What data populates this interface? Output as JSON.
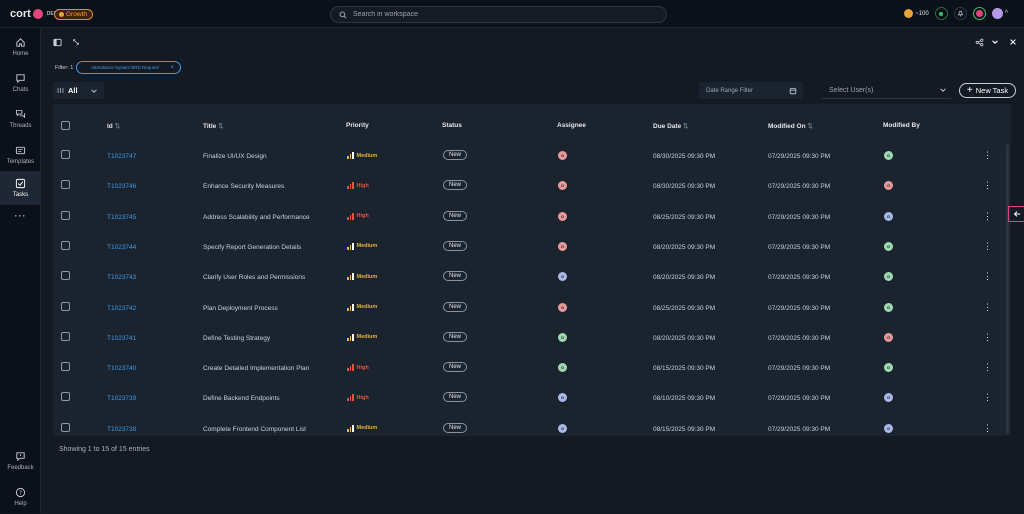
{
  "app": {
    "logo_text": "cort",
    "env": "DEV",
    "plan_badge": "Growth"
  },
  "search": {
    "placeholder": "Search in workspace"
  },
  "topbar": {
    "credits": "~100"
  },
  "sidebar": {
    "items": [
      {
        "label": "Home",
        "icon": "home-icon"
      },
      {
        "label": "Chats",
        "icon": "chat-icon"
      },
      {
        "label": "Threads",
        "icon": "threads-icon"
      },
      {
        "label": "Templates",
        "icon": "templates-icon"
      },
      {
        "label": "Tasks",
        "icon": "tasks-icon"
      },
      {
        "label": "Feedback",
        "icon": "feedback-icon"
      },
      {
        "label": "Help",
        "icon": "help-icon"
      }
    ]
  },
  "filter": {
    "count_label": "Filter: 1",
    "chip_label": "Attendance System BRD Request"
  },
  "view": {
    "selected": "All"
  },
  "controls": {
    "date_range_placeholder": "Date Range Filter",
    "user_select_placeholder": "Select User(s)",
    "new_task_label": "New Task"
  },
  "table": {
    "columns": [
      "Id",
      "Title",
      "Priority",
      "Status",
      "Assignee",
      "Due Date",
      "Modified On",
      "Modified By"
    ],
    "rows": [
      {
        "id": "T1023747",
        "title": "Finalize UI/UX Design",
        "priority": "Medium",
        "status": "New",
        "due": "08/30/2025 09:30 PM",
        "modified": "07/29/2025 09:30 PM",
        "assignee_color": "#e89a9a",
        "modby_color": "#9ed9b0"
      },
      {
        "id": "T1023746",
        "title": "Enhance Security Measures",
        "priority": "High",
        "status": "New",
        "due": "08/30/2025 09:30 PM",
        "modified": "07/29/2025 09:30 PM",
        "assignee_color": "#e89a9a",
        "modby_color": "#e89a9a"
      },
      {
        "id": "T1023745",
        "title": "Address Scalability and Performance",
        "priority": "High",
        "status": "New",
        "due": "08/25/2025 09:30 PM",
        "modified": "07/29/2025 09:30 PM",
        "assignee_color": "#e89a9a",
        "modby_color": "#a8b8e8"
      },
      {
        "id": "T1023744",
        "title": "Specify Report Generation Details",
        "priority": "Medium",
        "status": "New",
        "due": "08/20/2025 09:30 PM",
        "modified": "07/29/2025 09:30 PM",
        "assignee_color": "#e89a9a",
        "modby_color": "#9ed9b0"
      },
      {
        "id": "T1023743",
        "title": "Clarify User Roles and Permissions",
        "priority": "Medium",
        "status": "New",
        "due": "08/20/2025 09:30 PM",
        "modified": "07/29/2025 09:30 PM",
        "assignee_color": "#a8b8e8",
        "modby_color": "#9ed9b0"
      },
      {
        "id": "T1023742",
        "title": "Plan Deployment Process",
        "priority": "Medium",
        "status": "New",
        "due": "08/25/2025 09:30 PM",
        "modified": "07/29/2025 09:30 PM",
        "assignee_color": "#e89a9a",
        "modby_color": "#9ed9b0"
      },
      {
        "id": "T1023741",
        "title": "Define Testing Strategy",
        "priority": "Medium",
        "status": "New",
        "due": "08/20/2025 09:30 PM",
        "modified": "07/29/2025 09:30 PM",
        "assignee_color": "#9ed9b0",
        "modby_color": "#e89a9a"
      },
      {
        "id": "T1023740",
        "title": "Create Detailed Implementation Plan",
        "priority": "High",
        "status": "New",
        "due": "08/15/2025 09:30 PM",
        "modified": "07/29/2025 09:30 PM",
        "assignee_color": "#9ed9b0",
        "modby_color": "#9ed9b0"
      },
      {
        "id": "T1023739",
        "title": "Define Backend Endpoints",
        "priority": "High",
        "status": "New",
        "due": "08/10/2025 09:30 PM",
        "modified": "07/29/2025 09:30 PM",
        "assignee_color": "#a8b8e8",
        "modby_color": "#a8b8e8"
      },
      {
        "id": "T1023738",
        "title": "Complete Frontend Component List",
        "priority": "Medium",
        "status": "New",
        "due": "08/15/2025 09:30 PM",
        "modified": "07/29/2025 09:30 PM",
        "assignee_color": "#a8b8e8",
        "modby_color": "#a8b8e8"
      }
    ]
  },
  "footer": {
    "entries_text": "Showing 1 to 15 of 15 entries"
  },
  "colors": {
    "accent": "#3d9be9",
    "high": "#e5533d",
    "medium": "#e8b23a",
    "background": "#131a23"
  }
}
